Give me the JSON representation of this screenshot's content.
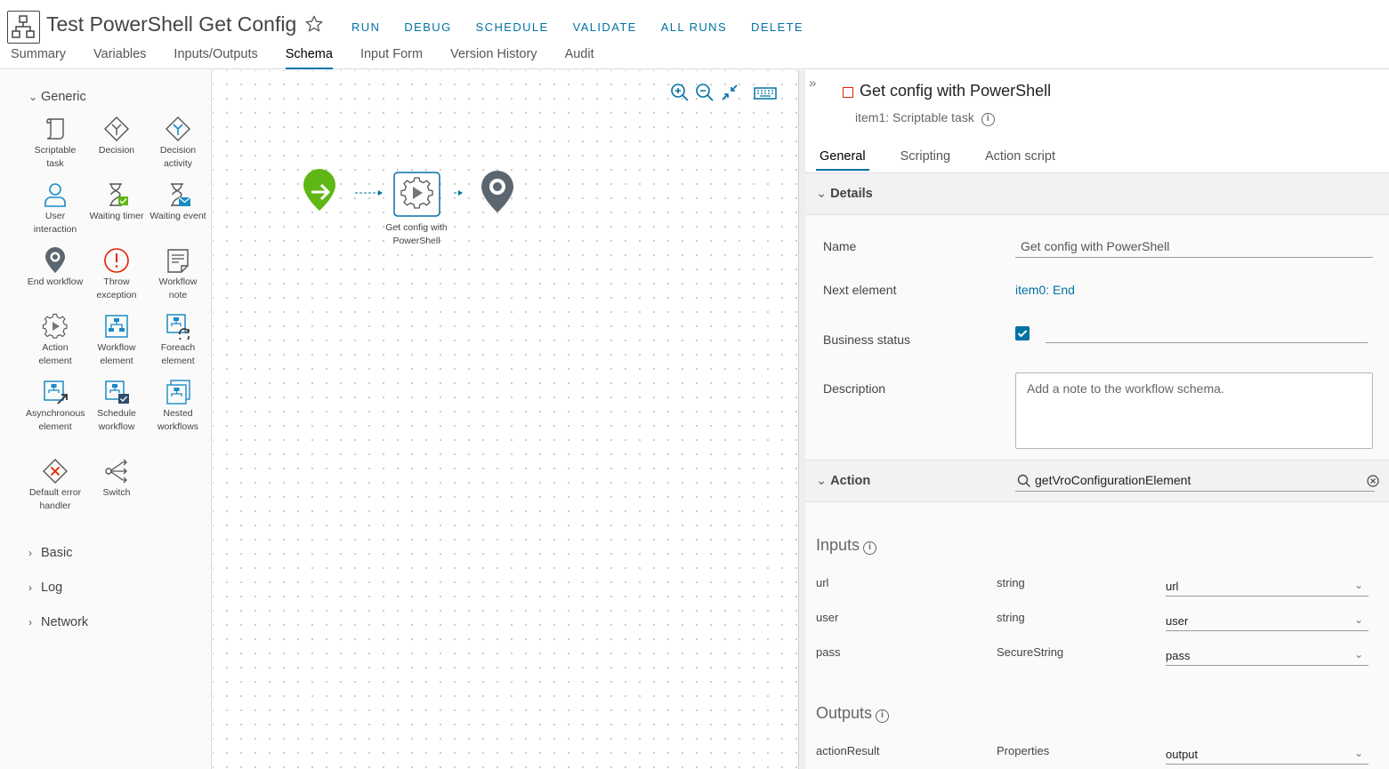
{
  "header": {
    "title": "Test PowerShell Get Config",
    "actions": [
      "RUN",
      "DEBUG",
      "SCHEDULE",
      "VALIDATE",
      "ALL RUNS",
      "DELETE"
    ],
    "tabs": [
      "Summary",
      "Variables",
      "Inputs/Outputs",
      "Schema",
      "Input Form",
      "Version History",
      "Audit"
    ],
    "active_tab": "Schema"
  },
  "palette": {
    "generic_label": "Generic",
    "items": [
      {
        "label": "Scriptable task",
        "icon": "scriptable-task-icon"
      },
      {
        "label": "Decision",
        "icon": "decision-icon"
      },
      {
        "label": "Decision activity",
        "icon": "decision-activity-icon"
      },
      {
        "label": "User interaction",
        "icon": "user-interaction-icon"
      },
      {
        "label": "Waiting timer",
        "icon": "waiting-timer-icon"
      },
      {
        "label": "Waiting event",
        "icon": "waiting-event-icon"
      },
      {
        "label": "End workflow",
        "icon": "end-workflow-icon"
      },
      {
        "label": "Throw exception",
        "icon": "throw-exception-icon"
      },
      {
        "label": "Workflow note",
        "icon": "workflow-note-icon"
      },
      {
        "label": "Action element",
        "icon": "action-element-icon"
      },
      {
        "label": "Workflow element",
        "icon": "workflow-element-icon"
      },
      {
        "label": "Foreach element",
        "icon": "foreach-element-icon"
      },
      {
        "label": "Asynchronous element",
        "icon": "asynchronous-element-icon"
      },
      {
        "label": "Schedule workflow",
        "icon": "schedule-workflow-icon"
      },
      {
        "label": "Nested workflows",
        "icon": "nested-workflows-icon"
      },
      {
        "label": "Default error handler",
        "icon": "default-error-handler-icon"
      },
      {
        "label": "Switch",
        "icon": "switch-icon"
      }
    ],
    "groups": [
      "Basic",
      "Log",
      "Network"
    ]
  },
  "canvas": {
    "node_label": "Get config with PowerShell"
  },
  "panel": {
    "element_title": "Get config with PowerShell",
    "element_subtitle": "item1: Scriptable task",
    "tabs": [
      "General",
      "Scripting",
      "Action script"
    ],
    "active_tab": "General",
    "details_label": "Details",
    "fields": {
      "name_label": "Name",
      "name_value": "Get config with PowerShell",
      "next_label": "Next element",
      "next_value": "item0: End",
      "business_label": "Business status",
      "business_checked": true,
      "description_label": "Description",
      "description_placeholder": "Add a note to the workflow schema."
    },
    "action_label": "Action",
    "action_value": "getVroConfigurationElement",
    "inputs_label": "Inputs",
    "inputs": [
      {
        "name": "url",
        "type": "string",
        "binding": "url"
      },
      {
        "name": "user",
        "type": "string",
        "binding": "user"
      },
      {
        "name": "pass",
        "type": "SecureString",
        "binding": "pass"
      }
    ],
    "outputs_label": "Outputs",
    "outputs": [
      {
        "name": "actionResult",
        "type": "Properties",
        "binding": "output"
      }
    ]
  },
  "colors": {
    "accent": "#0072a3",
    "start": "#5eb715",
    "end_marker": "#5b6670",
    "error": "#e12200"
  }
}
